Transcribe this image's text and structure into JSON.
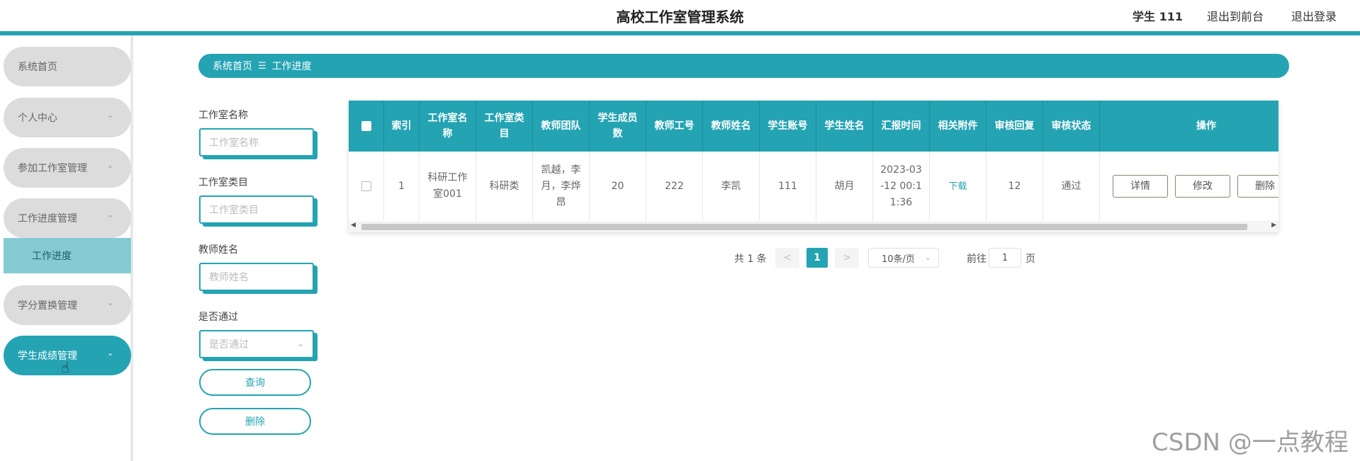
{
  "header": {
    "title": "高校工作室管理系统",
    "user": "学生 111",
    "to_front": "退出到前台",
    "logout": "退出登录"
  },
  "colors": {
    "accent": "#24a3b3",
    "submenu_active": "#86cbd4",
    "menu_bg": "#dcdcdc"
  },
  "sidebar": {
    "items": [
      {
        "label": "系统首页"
      },
      {
        "label": "个人中心"
      },
      {
        "label": "参加工作室管理"
      },
      {
        "label": "工作进度管理"
      },
      {
        "label": "学分置换管理"
      },
      {
        "label": "学生成绩管理"
      }
    ],
    "submenu": {
      "label": "工作进度"
    }
  },
  "breadcrumb": {
    "home": "系统首页",
    "sep": "☰",
    "current": "工作进度"
  },
  "search": {
    "studio_name_label": "工作室名称",
    "studio_name_placeholder": "工作室名称",
    "studio_category_label": "工作室类目",
    "studio_category_placeholder": "工作室类目",
    "teacher_name_label": "教师姓名",
    "teacher_name_placeholder": "教师姓名",
    "passed_label": "是否通过",
    "passed_placeholder": "是否通过",
    "query_button": "查询",
    "delete_button": "删除"
  },
  "table": {
    "headers": [
      "索引",
      "工作室名称",
      "工作室类目",
      "教师团队",
      "学生成员数",
      "教师工号",
      "教师姓名",
      "学生账号",
      "学生姓名",
      "汇报时间",
      "相关附件",
      "审核回复",
      "审核状态",
      "操作"
    ],
    "rows": [
      {
        "index": "1",
        "studio_name": "科研工作室001",
        "category": "科研类",
        "team": "凯越，李月，李烨昂",
        "member_count": "20",
        "teacher_no": "222",
        "teacher_name": "李凯",
        "student_account": "111",
        "student_name": "胡月",
        "report_time": "2023-03-12 00:11:36",
        "attachment": "下载",
        "review_reply": "12",
        "review_status": "通过"
      }
    ],
    "actions": {
      "detail": "详情",
      "edit": "修改",
      "delete": "删除"
    }
  },
  "pagination": {
    "total": "共 1 条",
    "prev": "<",
    "current_page": "1",
    "next": ">",
    "page_size": "10条/页",
    "goto_label": "前往",
    "goto_value": "1",
    "page_suffix": "页"
  },
  "watermark": "CSDN @一点教程"
}
